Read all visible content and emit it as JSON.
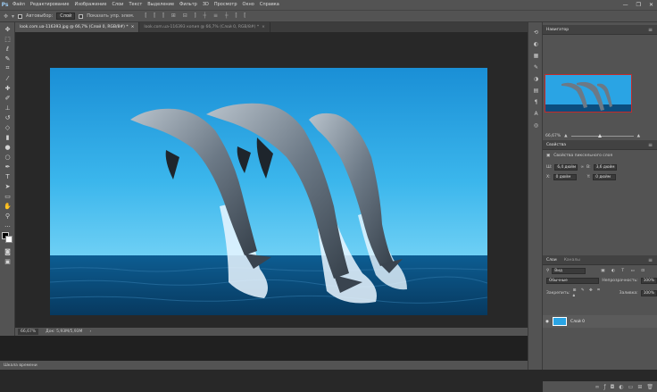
{
  "menu": {
    "items": [
      "Файл",
      "Редактирование",
      "Изображение",
      "Слои",
      "Текст",
      "Выделение",
      "Фильтр",
      "3D",
      "Просмотр",
      "Окно",
      "Справка"
    ],
    "logo": "Ps",
    "window_controls": [
      "—",
      "❐",
      "✕"
    ]
  },
  "options_bar": {
    "autoselect_label": "Автовыбор:",
    "autoselect_value": "Слой",
    "transform_label": "Показать упр. элем."
  },
  "tabs": [
    {
      "label": "look.com.ua-116393.jpg @ 66,7% (Слой 0, RGB/8#) *",
      "close": "×"
    },
    {
      "label": "look.com.ua-116393 копия @ 66,7% (Слой 0, RGB/8#) *",
      "close": "×"
    }
  ],
  "status": {
    "zoom": "66,67%",
    "doc": "Док: 5,93М/5,93М"
  },
  "timeline": {
    "label": "Шкала времени"
  },
  "navigator": {
    "title": "Навигатор",
    "zoom": "66,67%"
  },
  "properties": {
    "title": "Свойства",
    "subtitle": "Свойства пиксельного слоя",
    "w_label": "Ш:",
    "w_value": "6,4 дюйм",
    "h_label": "В:",
    "h_value": "3,6 дюйм",
    "x_label": "X:",
    "x_value": "0 дюйм",
    "y_label": "Y:",
    "y_value": "0 дюйм",
    "link_symbol": "∞"
  },
  "layers": {
    "tab_layers": "Слои",
    "tab_channels": "Каналы",
    "filter_value": "Вид",
    "blend_mode": "Обычные",
    "opacity_label": "Непрозрачность:",
    "opacity_value": "100%",
    "lock_label": "Закрепить:",
    "fill_label": "Заливка:",
    "fill_value": "100%",
    "layer_name": "Слой 0"
  },
  "colors": {
    "ui_bg": "#535353",
    "canvas_bg": "#282828",
    "sky": "#1ea0e0",
    "sea": "#0b4d7e"
  }
}
